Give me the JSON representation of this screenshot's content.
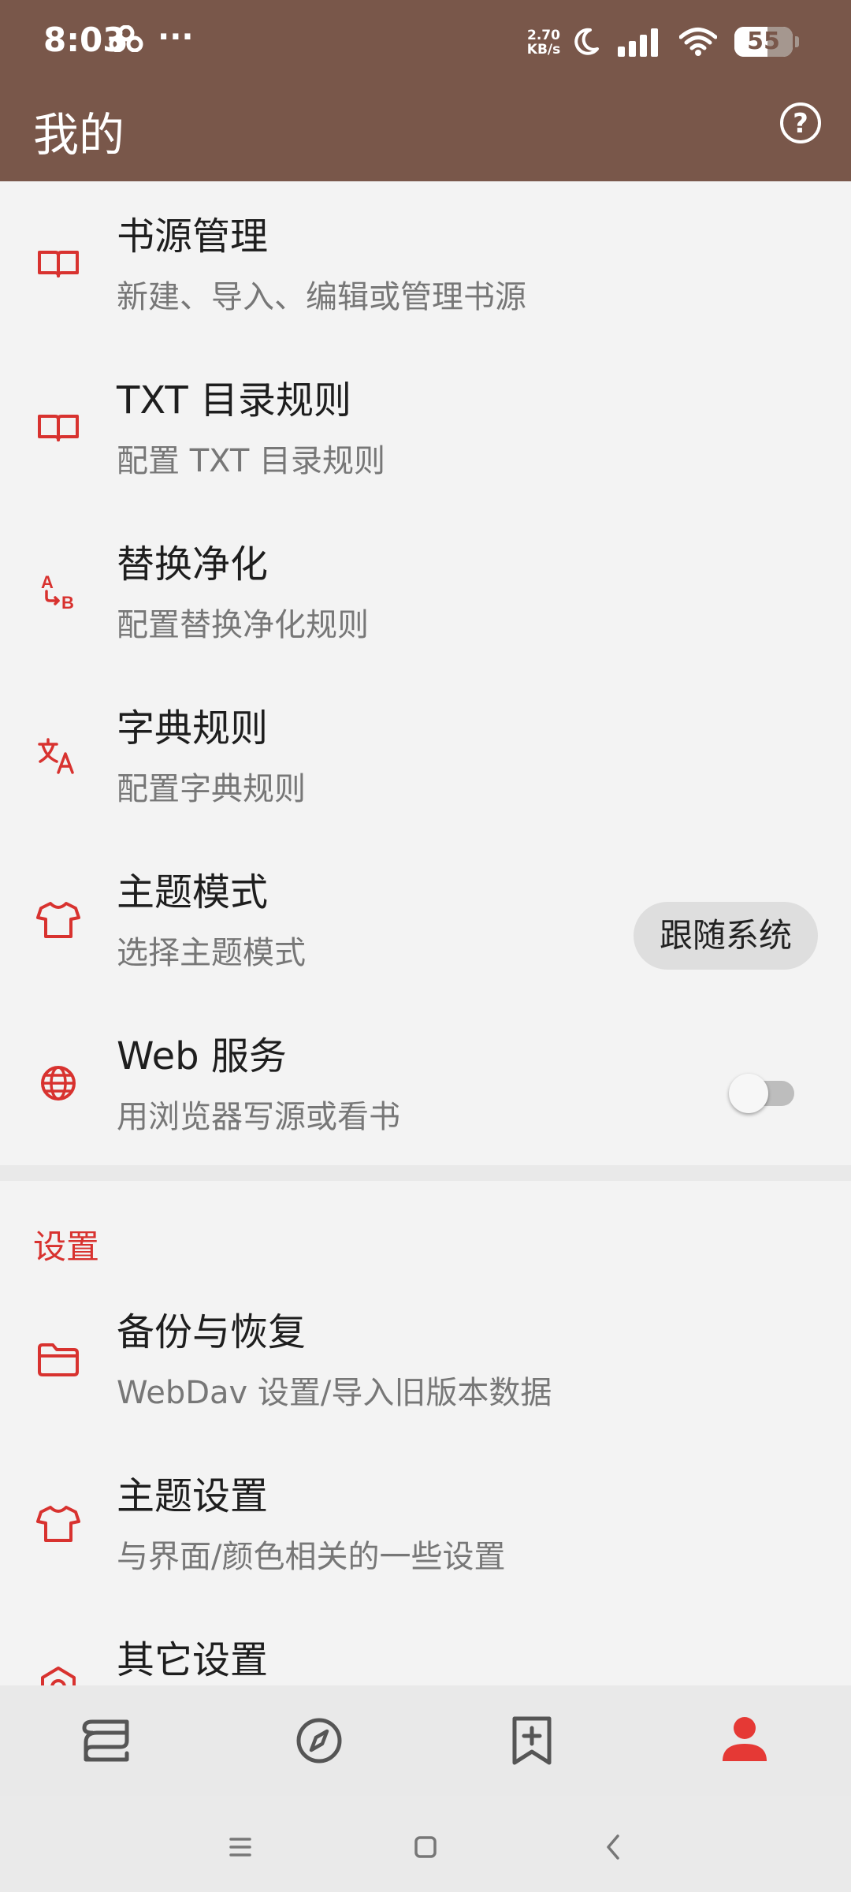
{
  "status_bar": {
    "time": "8:03",
    "more": "···",
    "net_speed_value": "2.70",
    "net_speed_unit": "KB/s",
    "battery": "55"
  },
  "header": {
    "title": "我的",
    "help_icon": "help-circle-icon"
  },
  "items": [
    {
      "title": "书源管理",
      "summary": "新建、导入、编辑或管理书源",
      "icon": "book-open-icon"
    },
    {
      "title": "TXT 目录规则",
      "summary": "配置 TXT 目录规则",
      "icon": "book-open-icon"
    },
    {
      "title": "替换净化",
      "summary": "配置替换净化规则",
      "icon": "replace-ab-icon"
    },
    {
      "title": "字典规则",
      "summary": "配置字典规则",
      "icon": "translate-icon"
    },
    {
      "title": "主题模式",
      "summary": "选择主题模式",
      "icon": "shirt-icon",
      "value": "跟随系统"
    },
    {
      "title": "Web 服务",
      "summary": "用浏览器写源或看书",
      "icon": "globe-icon",
      "switch_on": false
    }
  ],
  "settings": {
    "section_title": "设置",
    "items": [
      {
        "title": "备份与恢复",
        "summary": "WebDav 设置/导入旧版本数据",
        "icon": "folder-icon"
      },
      {
        "title": "主题设置",
        "summary": "与界面/颜色相关的一些设置",
        "icon": "shirt-icon"
      },
      {
        "title": "其它设置",
        "summary": "",
        "icon": "settings-icon"
      }
    ]
  },
  "bottom_nav": [
    {
      "icon": "bookshelf-icon",
      "active": false
    },
    {
      "icon": "compass-icon",
      "active": false
    },
    {
      "icon": "bookmark-add-icon",
      "active": false
    },
    {
      "icon": "person-icon",
      "active": true
    }
  ],
  "colors": {
    "header": "#79574a",
    "accent": "#d8322f",
    "background": "#f3f3f3"
  }
}
